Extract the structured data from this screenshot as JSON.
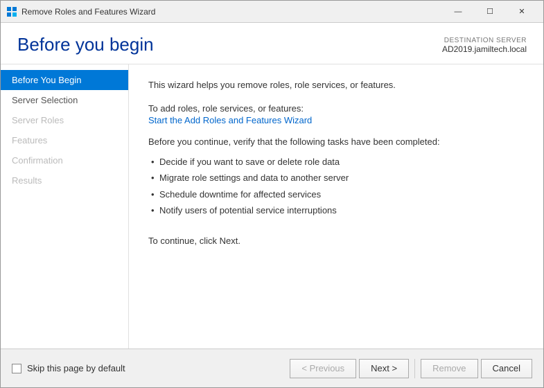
{
  "window": {
    "title": "Remove Roles and Features Wizard",
    "controls": {
      "minimize": "—",
      "maximize": "☐",
      "close": "✕"
    }
  },
  "page": {
    "title": "Before you begin",
    "destination_server_label": "DESTINATION SERVER",
    "destination_server_name": "AD2019.jamiltech.local"
  },
  "sidebar": {
    "items": [
      {
        "label": "Before You Begin",
        "state": "active"
      },
      {
        "label": "Server Selection",
        "state": "normal"
      },
      {
        "label": "Server Roles",
        "state": "disabled"
      },
      {
        "label": "Features",
        "state": "disabled"
      },
      {
        "label": "Confirmation",
        "state": "disabled"
      },
      {
        "label": "Results",
        "state": "disabled"
      }
    ]
  },
  "content": {
    "intro": "This wizard helps you remove roles, role services, or features.",
    "add_roles_prompt": "To add roles, role services, or features:",
    "add_roles_link": "Start the Add Roles and Features Wizard",
    "verify_prompt": "Before you continue, verify that the following tasks have been completed:",
    "bullet_items": [
      "Decide if you want to save or delete role data",
      "Migrate role settings and data to another server",
      "Schedule downtime for affected services",
      "Notify users of potential service interruptions"
    ],
    "continue_text": "To continue, click Next."
  },
  "footer": {
    "checkbox_label": "Skip this page by default",
    "buttons": {
      "previous": "< Previous",
      "next": "Next >",
      "remove": "Remove",
      "cancel": "Cancel"
    }
  }
}
